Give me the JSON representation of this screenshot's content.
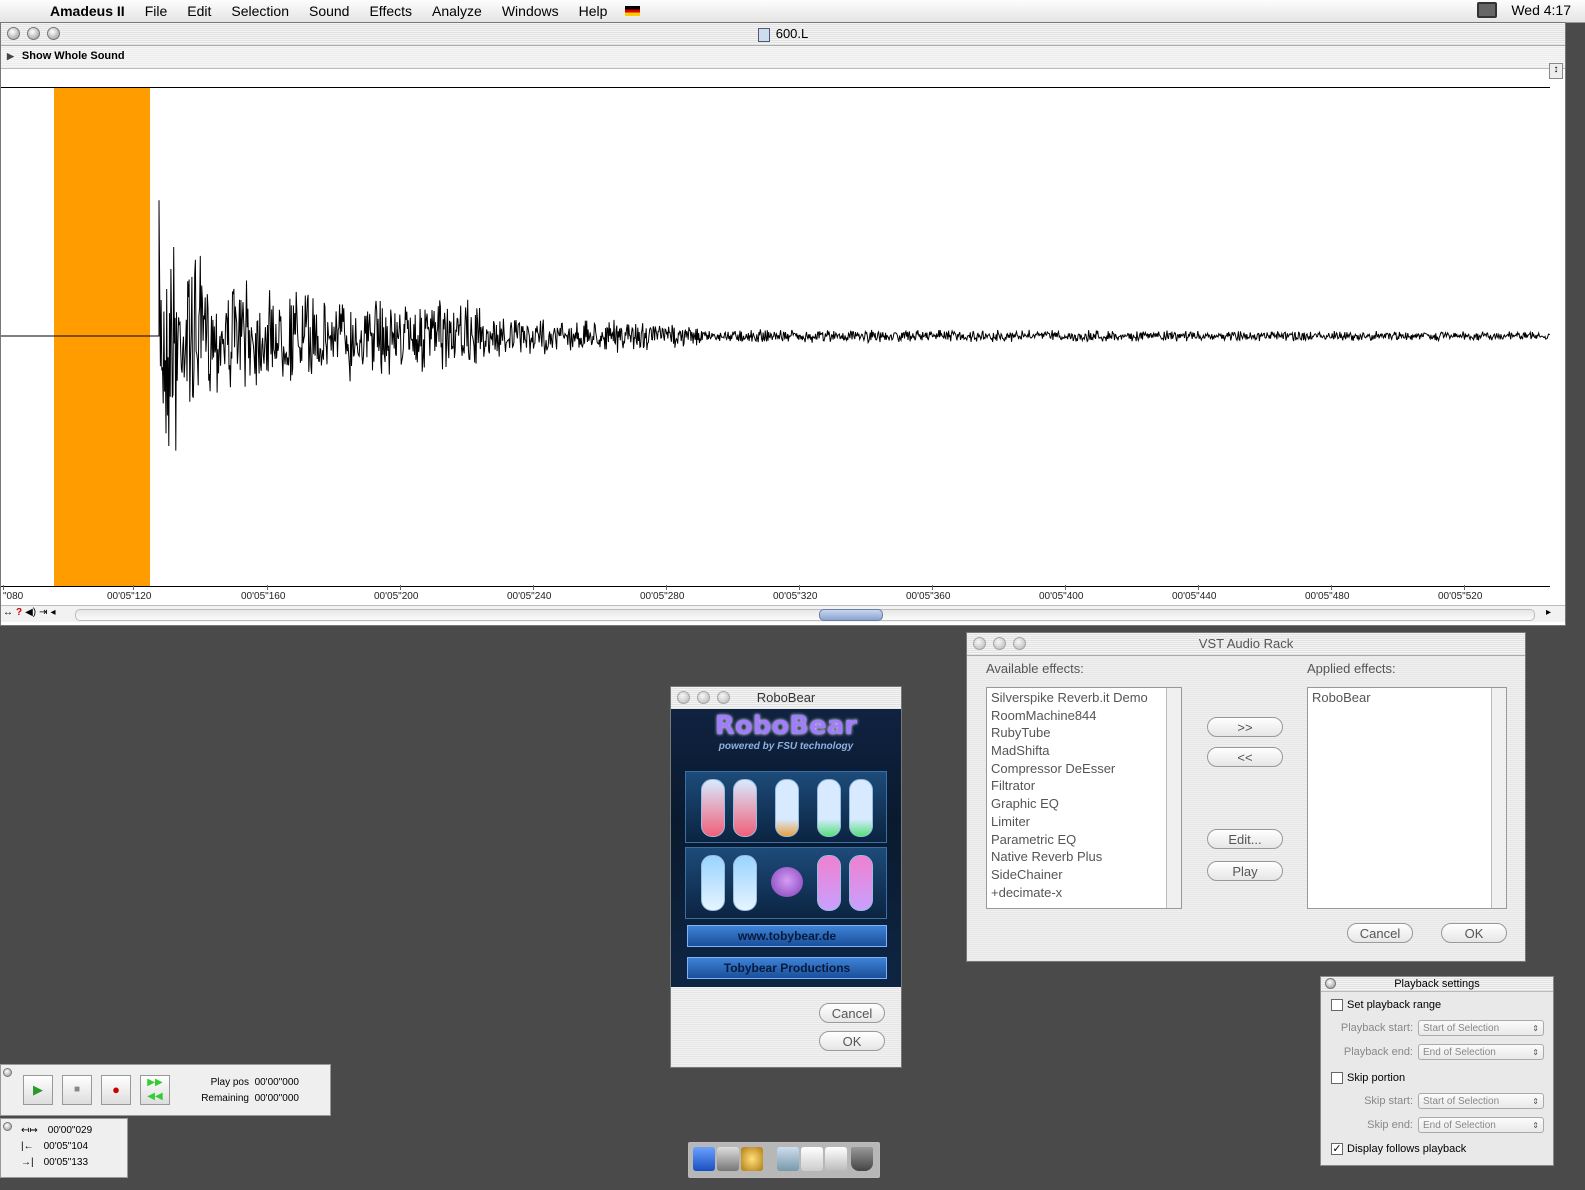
{
  "menubar": {
    "app_name": "Amadeus II",
    "menus": [
      "File",
      "Edit",
      "Selection",
      "Sound",
      "Effects",
      "Analyze",
      "Windows",
      "Help"
    ],
    "clock": "Wed 4:17"
  },
  "document": {
    "title": "600.L",
    "show_whole_sound": "Show Whole Sound",
    "selection_color": "#ff9d00",
    "ruler_labels": [
      "\"080",
      "00'05\"120",
      "00'05\"160",
      "00'05\"200",
      "00'05\"240",
      "00'05\"280",
      "00'05\"320",
      "00'05\"360",
      "00'05\"400",
      "00'05\"440",
      "00'05\"480",
      "00'05\"520"
    ]
  },
  "vst_rack": {
    "title": "VST Audio Rack",
    "available_label": "Available effects:",
    "applied_label": "Applied effects:",
    "available": [
      "Silverspike Reverb.it Demo",
      "RoomMachine844",
      "RubyTube",
      "MadShifta",
      "Compressor DeEsser",
      "Filtrator",
      "Graphic EQ",
      "Limiter",
      "Parametric EQ",
      "Native Reverb Plus",
      "SideChainer",
      "+decimate-x"
    ],
    "applied": [
      "RoboBear"
    ],
    "buttons": {
      "add": ">>",
      "remove": "<<",
      "edit": "Edit...",
      "play": "Play",
      "cancel": "Cancel",
      "ok": "OK"
    }
  },
  "robobear": {
    "title": "RoboBear",
    "logo": "RoboBear",
    "subtitle": "powered by FSU technology",
    "link1": "www.tobybear.de",
    "link2": "Tobybear Productions",
    "cancel": "Cancel",
    "ok": "OK"
  },
  "playback": {
    "title": "Playback settings",
    "set_range": "Set playback range",
    "start_label": "Playback start:",
    "start_value": "Start of Selection",
    "end_label": "Playback end:",
    "end_value": "End of Selection",
    "skip_portion": "Skip portion",
    "skip_start_label": "Skip start:",
    "skip_start_value": "Start of Selection",
    "skip_end_label": "Skip end:",
    "skip_end_value": "End of Selection",
    "display_follows": "Display follows playback",
    "display_follows_checked": true
  },
  "transport": {
    "play_pos_label": "Play pos",
    "play_pos": "00'00\"000",
    "remaining_label": "Remaining",
    "remaining": "00'00\"000"
  },
  "selection_info": {
    "length": "00'00\"029",
    "start": "00'05\"104",
    "end": "00'05\"133"
  }
}
